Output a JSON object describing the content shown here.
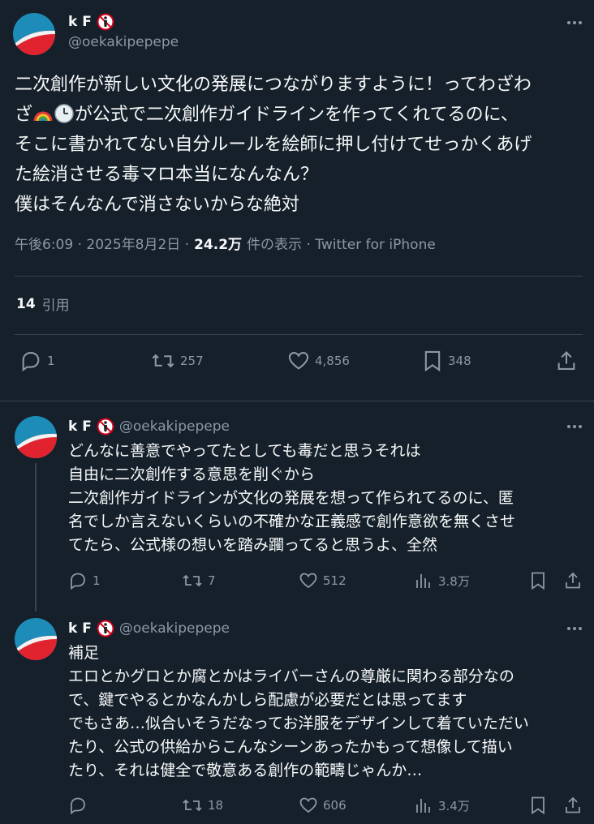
{
  "main_tweet": {
    "display_name": "k F",
    "handle": "@oekakipepepe",
    "text_before_emoji": "二次創作が新しい文化の発展につながりますように！ってわざわ\nざ",
    "emoji_names": [
      "rainbow-emoji",
      "clock-emoji"
    ],
    "text_after_emoji": "が公式で二次創作ガイドラインを作ってくれてるのに、\nそこに書かれてない自分ルールを絵師に押し付けてせっかくあげ\nた絵消させる毒マロ本当になんなん？\n僕はそんなんで消さないからな絶対",
    "timestamp": "午後6:09 · 2025年8月2日 ·",
    "views": "24.2万",
    "views_label": "件の表示 · Twitter for iPhone",
    "quote_count": "14",
    "quote_label": "引用",
    "replies": "1",
    "retweets": "257",
    "likes": "4,856",
    "bookmarks": "348"
  },
  "replies": [
    {
      "display_name": "k F",
      "handle": "@oekakipepepe",
      "text": "どんなに善意でやってたとしても毒だと思うそれは\n自由に二次創作する意思を削ぐから\n二次創作ガイドラインが文化の発展を想って作られてるのに、匿\n名でしか言えないくらいの不確かな正義感で創作意欲を無くさせ\nてたら、公式様の想いを踏み躙ってると思うよ、全然",
      "replies": "1",
      "retweets": "7",
      "likes": "512",
      "views": "3.8万"
    },
    {
      "display_name": "k F",
      "handle": "@oekakipepepe",
      "text": "補足\nエロとかグロとか腐とかはライバーさんの尊厳に関わる部分なの\nで、鍵でやるとかなんかしら配慮が必要だとは思ってます\nでもさあ…似合いそうだなってお洋服をデザインして着ていただい\nたり、公式の供給からこんなシーンあったかもって想像して描い\nたり、それは健全で敬意ある創作の範疇じゃんか…",
      "replies": "",
      "retweets": "18",
      "likes": "606",
      "views": "3.4万"
    }
  ],
  "colors": {
    "background": "#15202b",
    "text": "#f7f9f9",
    "muted": "#8b98a5",
    "divider": "#38444d",
    "avatar_bg": "#1d8cb8",
    "avatar_red": "#e0232f"
  }
}
